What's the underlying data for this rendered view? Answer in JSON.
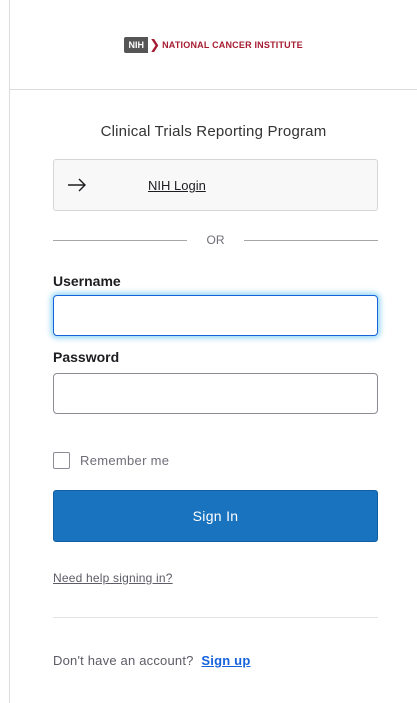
{
  "header": {
    "logo_abbrev": "NIH",
    "logo_text": "NATIONAL CANCER INSTITUTE",
    "brand_color": "#a51c30"
  },
  "title": "Clinical Trials Reporting Program",
  "idp": {
    "icon": "arrow-right-icon",
    "label": "NIH Login"
  },
  "separator": {
    "text": "OR"
  },
  "form": {
    "username_label": "Username",
    "username_value": "",
    "password_label": "Password",
    "password_value": "",
    "remember_label": "Remember me",
    "remember_checked": false,
    "submit_label": "Sign In"
  },
  "help": {
    "link_text": "Need help signing in?"
  },
  "signup": {
    "prompt": "Don't have an account?",
    "link_text": "Sign up"
  },
  "colors": {
    "primary_button": "#1a73be",
    "link": "#1662dd",
    "focus_ring": "#00a0e6"
  }
}
